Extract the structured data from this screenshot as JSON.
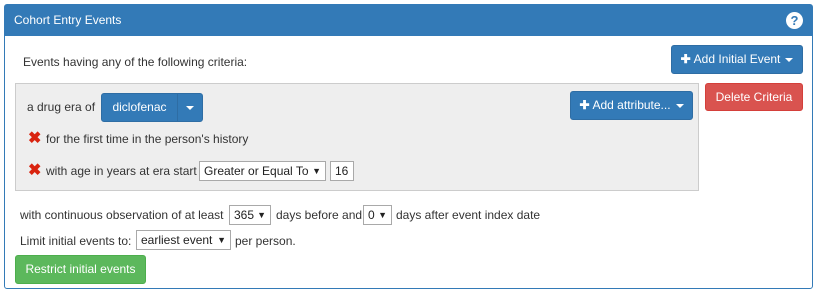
{
  "panel": {
    "title": "Cohort Entry Events",
    "help_icon": "question-circle-icon"
  },
  "events": {
    "intro": "Events having any of the following criteria:",
    "add_initial_event_label": "Add Initial Event",
    "delete_criteria_label": "Delete Criteria"
  },
  "criteria": {
    "drug_era_prefix": "a drug era of",
    "concept_set_value": "diclofenac",
    "add_attribute_label": "Add attribute...",
    "first_time_label": "for the first time in the person's history",
    "age_label": "with age in years at era start",
    "age_operator": "Greater or Equal To",
    "age_value": "16",
    "remove_icon": "x-icon"
  },
  "observation": {
    "prefix": "with continuous observation of at least",
    "days_before": "365",
    "mid": "days before and",
    "days_after": "0",
    "suffix": "days after event index date"
  },
  "limit": {
    "prefix": "Limit initial events to:",
    "value": "earliest event",
    "suffix": "per person."
  },
  "restrict_button": "Restrict initial events",
  "colors": {
    "primary": "#337ab7",
    "danger": "#d9534f",
    "success": "#5cb85c",
    "remove": "#d9230f"
  }
}
